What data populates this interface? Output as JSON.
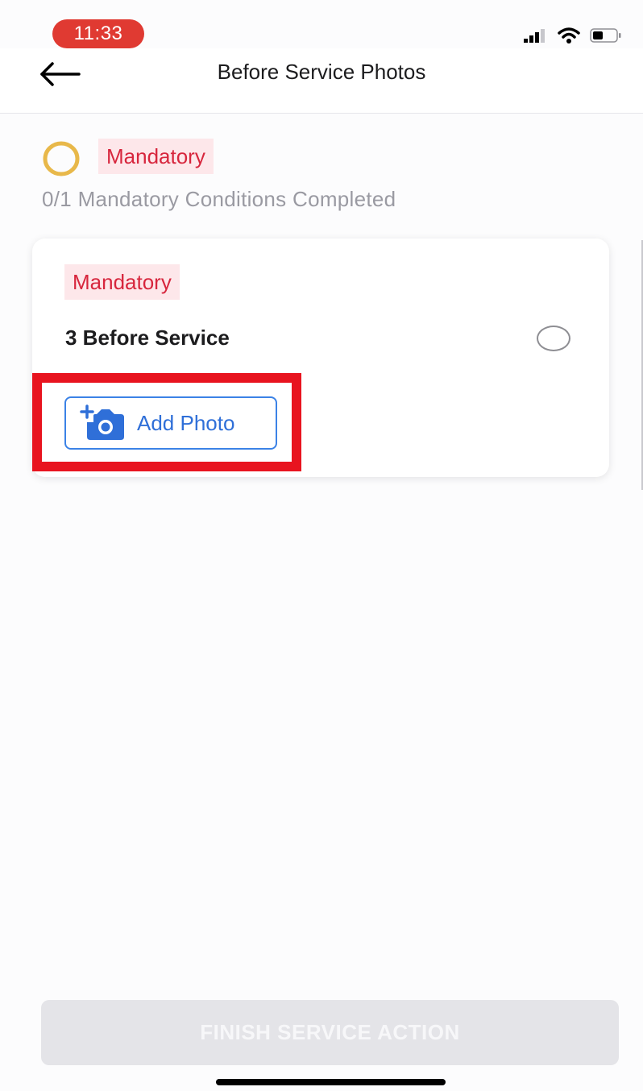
{
  "status_bar": {
    "time": "11:33",
    "icons": [
      "cellular-signal-icon",
      "wifi-icon",
      "battery-icon"
    ],
    "time_pill_color": "#e03a32"
  },
  "header": {
    "back_icon": "arrow-left-icon",
    "title": "Before Service Photos"
  },
  "summary": {
    "progress_icon": "progress-ring-icon",
    "progress_fraction": 0.0,
    "badge": "Mandatory",
    "completed_text": "0/1 Mandatory Conditions Completed"
  },
  "condition_card": {
    "badge": "Mandatory",
    "title": "3 Before Service",
    "checked": false,
    "add_photo_label": "Add Photo",
    "add_photo_icon": "camera-add-icon"
  },
  "footer": {
    "finish_label": "FINISH SERVICE ACTION",
    "finish_enabled": false
  },
  "colors": {
    "accent_blue": "#3b82e6",
    "mandatory_red": "#d7263d",
    "mandatory_bg": "#fde7ea",
    "highlight_red": "#e8141f",
    "progress_ring": "#e8b84a"
  }
}
